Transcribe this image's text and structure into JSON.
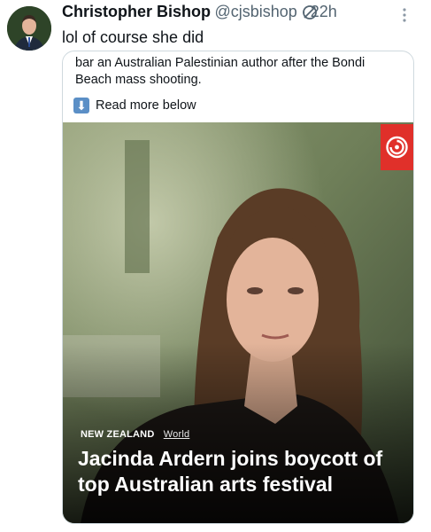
{
  "tweet": {
    "display_name": "Christopher Bishop",
    "handle": "@cjsbishop",
    "separator": "·",
    "time": "22h",
    "text": "lol of course she did",
    "edited_icon": "edited-icon",
    "more_icon": "more-options-icon"
  },
  "card": {
    "snippet": "bar an Australian Palestinian author after the Bondi Beach mass shooting.",
    "read_more": {
      "icon": "down-arrow-icon",
      "label": "Read more below"
    },
    "article": {
      "region": "NEW ZEALAND",
      "section": "World",
      "headline": "Jacinda Ardern joins boycott of top Australian arts festival",
      "logo_icon": "rnz-logo-icon",
      "badge_color": "#e0302a"
    }
  }
}
